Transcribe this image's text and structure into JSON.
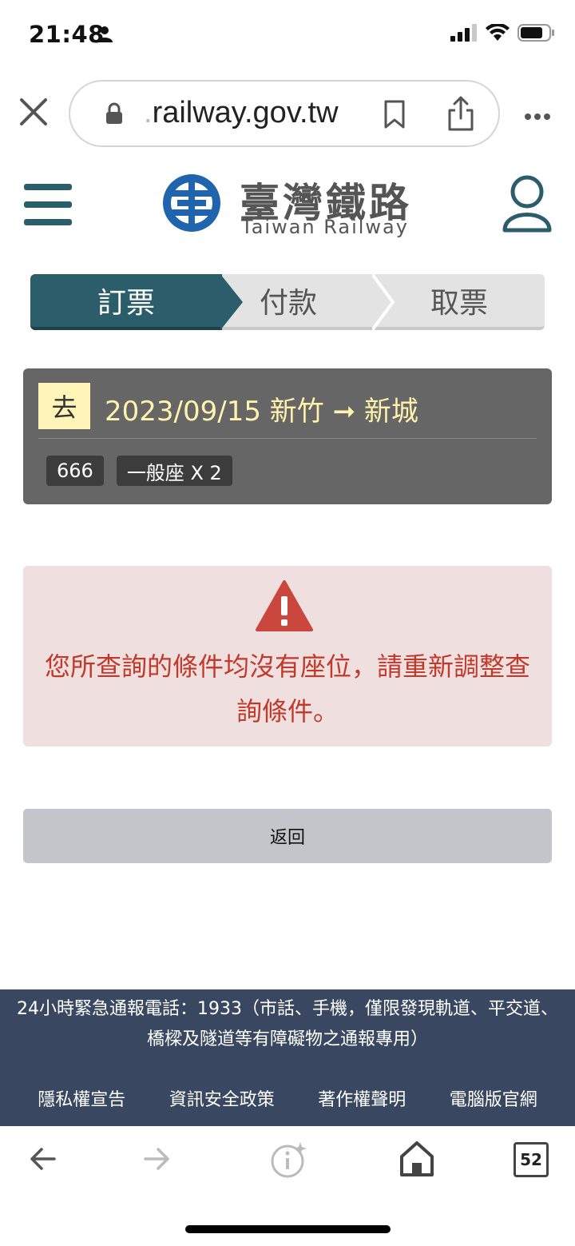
{
  "status_bar": {
    "time": "21:48",
    "battery_level": 0.75,
    "cellular_bars": 3
  },
  "browser": {
    "url_prefix": ".",
    "url_main": "railway.gov.tw"
  },
  "header": {
    "logo_title": "臺灣鐵路",
    "logo_subtitle": "Taiwan Railway",
    "brand_color": "#2b5d6b"
  },
  "steps": [
    {
      "label": "訂票",
      "active": true
    },
    {
      "label": "付款",
      "active": false
    },
    {
      "label": "取票",
      "active": false
    }
  ],
  "trip": {
    "direction_badge": "去",
    "route": "2023/09/15 新竹 ➞ 新城",
    "train_no": "666",
    "seat_info": "一般座 X 2"
  },
  "alert": {
    "message": "您所查詢的條件均沒有座位，請重新調整查詢條件。",
    "color": "#c0392b"
  },
  "back_button": {
    "label": "返回"
  },
  "footer": {
    "notice": "24小時緊急通報電話：1933（市話、手機，僅限發現軌道、平交道、橋樑及隧道等有障礙物之通報專用）",
    "links": [
      "隱私權宣告",
      "資訊安全政策",
      "著作權聲明",
      "電腦版官網"
    ],
    "background": "#394860"
  },
  "browser_nav": {
    "tab_count": "52"
  }
}
